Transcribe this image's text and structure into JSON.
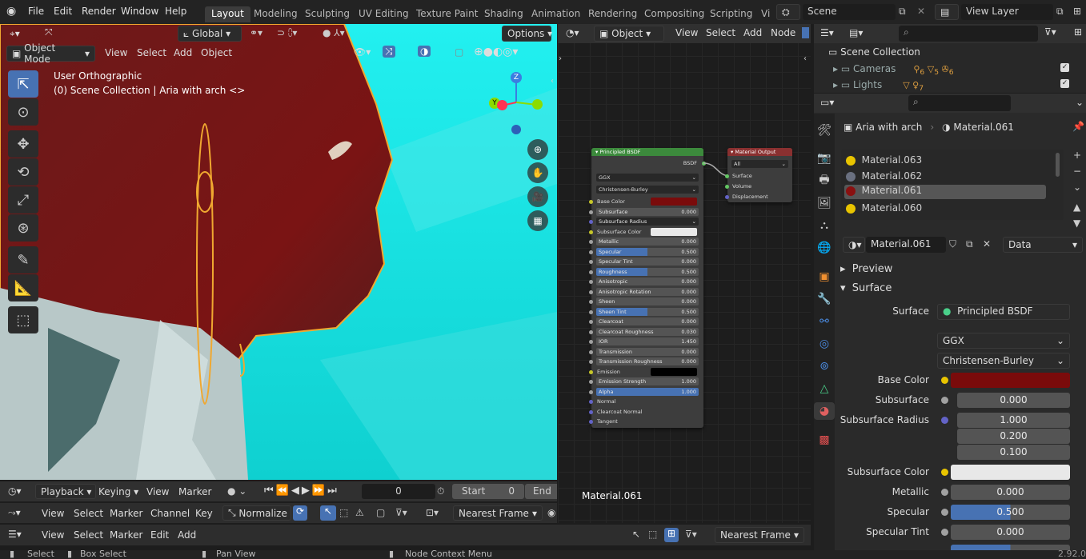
{
  "topbar": {
    "menus": [
      "File",
      "Edit",
      "Render",
      "Window",
      "Help"
    ],
    "workspaces": [
      "Layout",
      "Modeling",
      "Sculpting",
      "UV Editing",
      "Texture Paint",
      "Shading",
      "Animation",
      "Rendering",
      "Compositing",
      "Scripting",
      "Vi"
    ],
    "active_workspace": "Layout",
    "scene": "Scene",
    "view_layer": "View Layer"
  },
  "viewport": {
    "orientation": "Global",
    "options": "Options",
    "mode": "Object Mode",
    "menus": [
      "View",
      "Select",
      "Add",
      "Object"
    ],
    "overlay_line1": "User Orthographic",
    "overlay_line2": "(0) Scene Collection | Aria with arch  <>",
    "gizmo": {
      "z": "Z",
      "y": "Y",
      "x": "X"
    }
  },
  "node_editor": {
    "type": "Object",
    "menus": [
      "View",
      "Select",
      "Add",
      "Node"
    ],
    "material_label": "Material.061",
    "bsdf": {
      "title": "Principled BSDF",
      "output": "BSDF",
      "dist": "GGX",
      "sss_method": "Christensen-Burley",
      "rows": [
        [
          "Base Color",
          ""
        ],
        [
          "Subsurface",
          "0.000"
        ],
        [
          "Subsurface Radius",
          ""
        ],
        [
          "Subsurface Color",
          ""
        ],
        [
          "Metallic",
          "0.000"
        ],
        [
          "Specular",
          "0.500"
        ],
        [
          "Specular Tint",
          "0.000"
        ],
        [
          "Roughness",
          "0.500"
        ],
        [
          "Anisotropic",
          "0.000"
        ],
        [
          "Anisotropic Rotation",
          "0.000"
        ],
        [
          "Sheen",
          "0.000"
        ],
        [
          "Sheen Tint",
          "0.500"
        ],
        [
          "Clearcoat",
          "0.000"
        ],
        [
          "Clearcoat Roughness",
          "0.030"
        ],
        [
          "IOR",
          "1.450"
        ],
        [
          "Transmission",
          "0.000"
        ],
        [
          "Transmission Roughness",
          "0.000"
        ],
        [
          "Emission",
          ""
        ],
        [
          "Emission Strength",
          "1.000"
        ],
        [
          "Alpha",
          "1.000"
        ],
        [
          "Normal",
          ""
        ],
        [
          "Clearcoat Normal",
          ""
        ],
        [
          "Tangent",
          ""
        ]
      ]
    },
    "output": {
      "title": "Material Output",
      "target": "All",
      "sockets": [
        "Surface",
        "Volume",
        "Displacement"
      ]
    }
  },
  "outliner": {
    "root": "Scene Collection",
    "items": [
      {
        "label": "Cameras",
        "badges": [
          "6",
          "5",
          "6"
        ]
      },
      {
        "label": "Lights",
        "badges": [
          "7"
        ]
      }
    ]
  },
  "properties": {
    "object": "Aria with arch",
    "material": "Material.061",
    "slots": [
      "Material.063",
      "Material.062",
      "Material.061",
      "Material.060"
    ],
    "material_name": "Material.061",
    "link": "Data",
    "preview": "Preview",
    "surface_header": "Surface",
    "surface_label": "Surface",
    "surface_value": "Principled BSDF",
    "dist": "GGX",
    "sss_method": "Christensen-Burley",
    "rows": [
      {
        "label": "Base Color",
        "value": ""
      },
      {
        "label": "Subsurface",
        "value": "0.000"
      },
      {
        "label": "Subsurface Radius",
        "value": "1.000"
      },
      {
        "label": "",
        "value": "0.200"
      },
      {
        "label": "",
        "value": "0.100"
      },
      {
        "label": "Subsurface Color",
        "value": ""
      },
      {
        "label": "Metallic",
        "value": "0.000"
      },
      {
        "label": "Specular",
        "value": "0.500"
      },
      {
        "label": "Specular Tint",
        "value": "0.000"
      }
    ]
  },
  "timeline": {
    "playback": "Playback",
    "keying": "Keying",
    "view": "View",
    "marker": "Marker",
    "frame": "0",
    "start_label": "Start",
    "start": "0",
    "end_label": "End"
  },
  "graph": {
    "menus": [
      "View",
      "Select",
      "Marker",
      "Channel",
      "Key"
    ],
    "normalize": "Normalize",
    "interp": "Nearest Frame"
  },
  "nla": {
    "menus": [
      "View",
      "Select",
      "Marker",
      "Edit",
      "Add"
    ],
    "interp": "Nearest Frame"
  },
  "status": {
    "select": "Select",
    "box": "Box Select",
    "pan": "Pan View",
    "ctx": "Node Context Menu",
    "version": "2.92.0"
  },
  "colors": {
    "accent": "#4772b3",
    "base_color": "#7a0b0b",
    "cyan": "#16e8e8"
  }
}
